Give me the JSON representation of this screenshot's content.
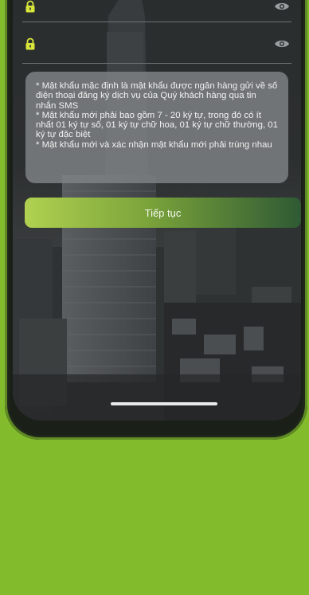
{
  "form": {
    "password_field": {
      "value": "",
      "placeholder": ""
    },
    "confirm_field": {
      "value": "",
      "placeholder": ""
    }
  },
  "note": {
    "lines": [
      "* Mật khẩu mặc định là mật khẩu được ngân hàng gửi về số điện thoại đăng ký dịch vụ của Quý khách hàng qua tin nhắn SMS",
      "* Mật khẩu mới phải bao gồm 7 - 20 ký tự, trong đó có ít nhất 01 ký tự số, 01 ký tự chữ hoa, 01 ký tự chữ thường, 01 ký tự đặc biệt",
      "* Mật khẩu mới và xác nhận mật khẩu mới phải trùng nhau"
    ]
  },
  "actions": {
    "continue_label": "Tiếp tục"
  },
  "colors": {
    "background": "#82bb2c",
    "accent_start": "#b0d150",
    "accent_end": "#2f5a34",
    "icon_yellow": "#d8e63a"
  },
  "icons": {
    "field_icon": "lock-icon",
    "toggle_icon": "eye-icon"
  }
}
